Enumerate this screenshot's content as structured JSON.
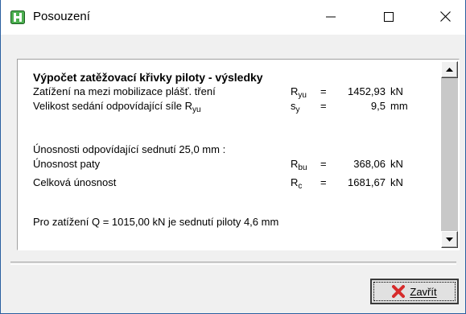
{
  "window": {
    "title": "Posouzení",
    "icon": "posouzeni-app-icon",
    "controls": {
      "minimize": "minimize-icon",
      "maximize": "maximize-icon",
      "close": "close-icon"
    }
  },
  "results": {
    "heading": "Výpočet zatěžovací křivky piloty - výsledky",
    "rows": [
      {
        "label": "Zatížení na mezi mobilizace plášť. tření",
        "symbol": "R",
        "sub": "yu",
        "eq": "=",
        "value": "1452,93",
        "unit": "kN"
      },
      {
        "label": "Velikost sedání odpovídající síle R",
        "label_sub": "yu",
        "symbol": "s",
        "sub": "y",
        "eq": "=",
        "value": "9,5",
        "unit": "mm"
      }
    ],
    "capacity_heading": "Únosnosti odpovídající sednutí 25,0 mm :",
    "capacity_rows": [
      {
        "label": "Únosnost paty",
        "symbol": "R",
        "sub": "bu",
        "eq": "=",
        "value": "368,06",
        "unit": "kN"
      },
      {
        "label": "Celková únosnost",
        "symbol": "R",
        "sub": "c",
        "eq": "=",
        "value": "1681,67",
        "unit": "kN"
      }
    ],
    "summary": "Pro zatížení Q = 1015,00 kN je sednutí piloty 4,6 mm"
  },
  "footer": {
    "close_label": "Zavřít",
    "close_icon": "red-x-icon",
    "accent": "#d62b2b"
  }
}
